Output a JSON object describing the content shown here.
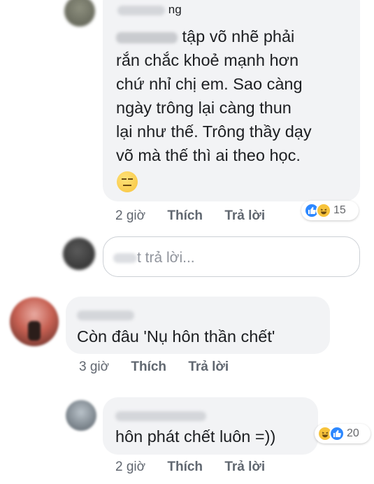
{
  "comments": [
    {
      "name_suffix": "ng",
      "lines": [
        "tập võ nhẽ phải",
        "rắn chắc khoẻ mạnh hơn",
        "chứ nhỉ chị em. Sao càng",
        "ngày trông lại càng thun",
        "lại như thế. Trông thầy dạy",
        "võ mà thế thì ai theo học."
      ],
      "emoji": "😑",
      "time": "2 giờ",
      "like_label": "Thích",
      "reply_label": "Trả lời",
      "reaction_count": "15"
    },
    {
      "text": "Còn đâu 'Nụ hôn thần chết'",
      "time": "3 giờ",
      "like_label": "Thích",
      "reply_label": "Trả lời"
    },
    {
      "text": "hôn phát chết luôn =))",
      "time": "2 giờ",
      "like_label": "Thích",
      "reply_label": "Trả lời",
      "reaction_count": "20"
    }
  ],
  "reply_box": {
    "placeholder_tail": "t trả lời..."
  },
  "colors": {
    "bubble": "#f2f3f5",
    "like_blue": "#2d88ff",
    "haha_yellow": "#f7c33b",
    "meta_gray": "#616770"
  }
}
